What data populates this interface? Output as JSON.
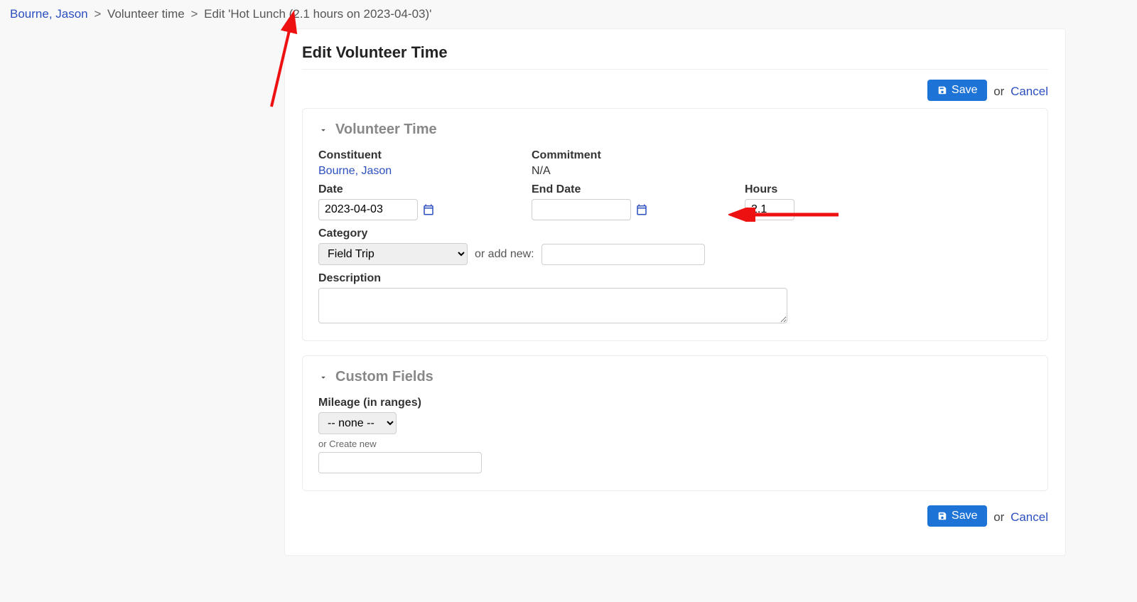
{
  "breadcrumb": {
    "link1": "Bourne, Jason",
    "link2": "Volunteer time",
    "current": "Edit 'Hot Lunch (2.1 hours on 2023-04-03)'"
  },
  "page_title": "Edit Volunteer Time",
  "buttons": {
    "save": "Save",
    "or": "or",
    "cancel": "Cancel"
  },
  "panels": {
    "volunteer_time": {
      "title": "Volunteer Time",
      "constituent_label": "Constituent",
      "constituent_value": "Bourne, Jason",
      "commitment_label": "Commitment",
      "commitment_value": "N/A",
      "date_label": "Date",
      "date_value": "2023-04-03",
      "end_date_label": "End Date",
      "end_date_value": "",
      "hours_label": "Hours",
      "hours_value": "2.1",
      "category_label": "Category",
      "category_value": "Field Trip",
      "add_new_text": "or add new:",
      "add_new_value": "",
      "description_label": "Description",
      "description_value": ""
    },
    "custom_fields": {
      "title": "Custom Fields",
      "mileage_label": "Mileage (in ranges)",
      "mileage_value": "-- none --",
      "create_new_text": "or Create new",
      "create_new_value": ""
    }
  }
}
